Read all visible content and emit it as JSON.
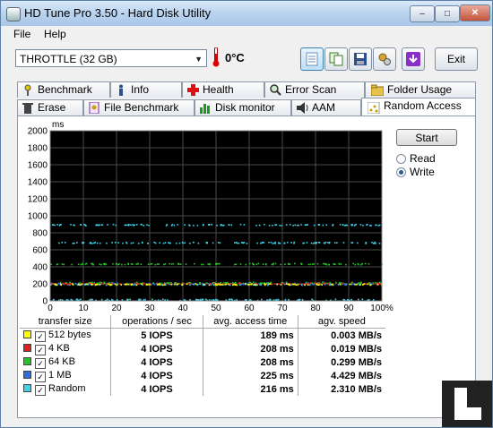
{
  "window": {
    "title": "HD Tune Pro 3.50 - Hard Disk Utility"
  },
  "menu": {
    "items": [
      "File",
      "Help"
    ]
  },
  "toolbar": {
    "drive": "THROTTLE (32 GB)",
    "temperature": "0°C",
    "exit_label": "Exit",
    "icons": [
      "info-icon",
      "copy-icon",
      "save-icon",
      "options-icon",
      "download-icon"
    ]
  },
  "tabs": {
    "row1": [
      "Benchmark",
      "Info",
      "Health",
      "Error Scan",
      "Folder Usage"
    ],
    "row2": [
      "Erase",
      "File Benchmark",
      "Disk monitor",
      "AAM",
      "Random Access"
    ],
    "active": "Random Access"
  },
  "controls": {
    "start_label": "Start",
    "read_label": "Read",
    "write_label": "Write",
    "selected": "Write"
  },
  "table": {
    "headers": [
      "transfer size",
      "operations / sec",
      "avg. access time",
      "agv. speed"
    ],
    "rows": [
      {
        "size": "512 bytes",
        "color": "#ffff00",
        "ops": "5 IOPS",
        "access": "189 ms",
        "speed": "0.003 MB/s"
      },
      {
        "size": "4 KB",
        "color": "#e0201c",
        "ops": "4 IOPS",
        "access": "208 ms",
        "speed": "0.019 MB/s"
      },
      {
        "size": "64 KB",
        "color": "#27c427",
        "ops": "4 IOPS",
        "access": "208 ms",
        "speed": "0.299 MB/s"
      },
      {
        "size": "1 MB",
        "color": "#2a6fe0",
        "ops": "4 IOPS",
        "access": "225 ms",
        "speed": "4.429 MB/s"
      },
      {
        "size": "Random",
        "color": "#3fd2e8",
        "ops": "4 IOPS",
        "access": "216 ms",
        "speed": "2.310 MB/s"
      }
    ]
  },
  "chart_data": {
    "type": "scatter",
    "ylabel": "ms",
    "ylim": [
      0,
      2000
    ],
    "xlim": [
      0,
      100
    ],
    "yticks": [
      "0",
      "200",
      "400",
      "600",
      "800",
      "1000",
      "1200",
      "1400",
      "1600",
      "1800",
      "2000"
    ],
    "xticks": [
      "0",
      "10",
      "20",
      "30",
      "40",
      "50",
      "60",
      "70",
      "80",
      "90",
      "100%"
    ],
    "grid": true,
    "series": [
      {
        "name": "Random",
        "color": "#3fd2e8",
        "levels": [
          20,
          200,
          690,
          900
        ]
      },
      {
        "name": "1 MB",
        "color": "#2a6fe0",
        "levels": [
          210
        ]
      },
      {
        "name": "64 KB",
        "color": "#27c427",
        "levels": [
          220,
          440
        ]
      },
      {
        "name": "4 KB",
        "color": "#e0201c",
        "levels": [
          210
        ]
      },
      {
        "name": "512 bytes",
        "color": "#ffff00",
        "levels": [
          200
        ]
      }
    ]
  }
}
